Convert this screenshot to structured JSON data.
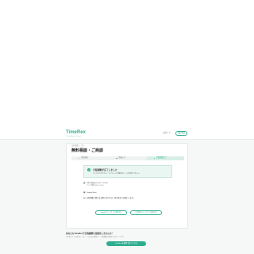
{
  "header": {
    "logo": "TimeRex",
    "logo_sub": "Scheduling for Teams",
    "login": "ログイン",
    "signup": "無料登録"
  },
  "breadcrumb": "日程調整 ＞ 完了",
  "page_title": "無料相談・ご商談",
  "steps": [
    "日時選択",
    "情報入力",
    "日程調整完了"
  ],
  "active_step_index": 2,
  "success": {
    "title": "日程調整が完了しました",
    "desc": "ご入力いただいたメールアドレスに確認のメールを送信しました。"
  },
  "details": {
    "datetime": "7月28日(木) 10:00 〜 10:30",
    "datetime_sub": "アジア/東京 (UTC+9:00)",
    "location": "Google Meet",
    "note": "日程調整に関するお問い合わせは、担当者までお願いします。"
  },
  "actions": {
    "calendar": "Googleカレンダーに追加する",
    "other_calendar": "その他のカレンダーに追加する"
  },
  "bottom": {
    "question": "あなたもTimeRexで日程調整を自動化しませんか？",
    "desc": "TimeRexは、Googleカレンダー・Outlookと連携して、日程調整を自動化できるツールです。",
    "cta": "TimeRexを無料で使ってみる"
  },
  "colors": {
    "accent": "#2fae8f",
    "success_bg": "#eaf6f1",
    "page_bg": "#f6f8f7"
  }
}
